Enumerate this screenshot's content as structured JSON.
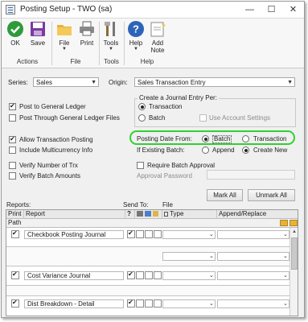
{
  "window": {
    "title": "Posting Setup  -  TWO (sa)"
  },
  "ribbon": {
    "ok": "OK",
    "save": "Save",
    "file": "File",
    "print": "Print",
    "tools": "Tools",
    "help": "Help",
    "add_note_1": "Add",
    "add_note_2": "Note",
    "groups": {
      "actions": "Actions",
      "file": "File",
      "tools": "Tools",
      "help": "Help"
    }
  },
  "form": {
    "series_label": "Series:",
    "series_value": "Sales",
    "origin_label": "Origin:",
    "origin_value": "Sales Transaction Entry",
    "post_gl": "Post to General Ledger",
    "post_through_gl": "Post Through General Ledger Files",
    "journal_group": "Create a Journal Entry Per:",
    "je_transaction": "Transaction",
    "je_batch": "Batch",
    "use_account_settings": "Use Account Settings",
    "allow_trx_posting": "Allow Transaction Posting",
    "include_multicurrency": "Include Multicurrency Info",
    "posting_date_from": "Posting Date From:",
    "pd_batch": "Batch",
    "pd_transaction": "Transaction",
    "if_existing_batch": "If Existing Batch:",
    "eb_append": "Append",
    "eb_create_new": "Create New",
    "verify_num_trx": "Verify Number of Trx",
    "verify_batch_amounts": "Verify Batch Amounts",
    "require_batch_approval": "Require Batch Approval",
    "approval_password": "Approval Password",
    "mark_all": "Mark All",
    "unmark_all": "Unmark All"
  },
  "reports": {
    "reports_label": "Reports:",
    "send_to_label": "Send To:",
    "file_label": "File",
    "col_print": "Print",
    "col_report": "Report",
    "col_question": "?",
    "col_type": "Type",
    "col_append_replace": "Append/Replace",
    "path_label": "Path",
    "rows": [
      {
        "name": "Checkbook Posting Journal"
      },
      {
        "name": "Cost Variance Journal"
      },
      {
        "name": "Dist Breakdown - Detail"
      }
    ]
  },
  "colors": {
    "highlight": "#2fd12f",
    "ok_green": "#2e9a3a",
    "help_blue": "#2d64b8"
  }
}
